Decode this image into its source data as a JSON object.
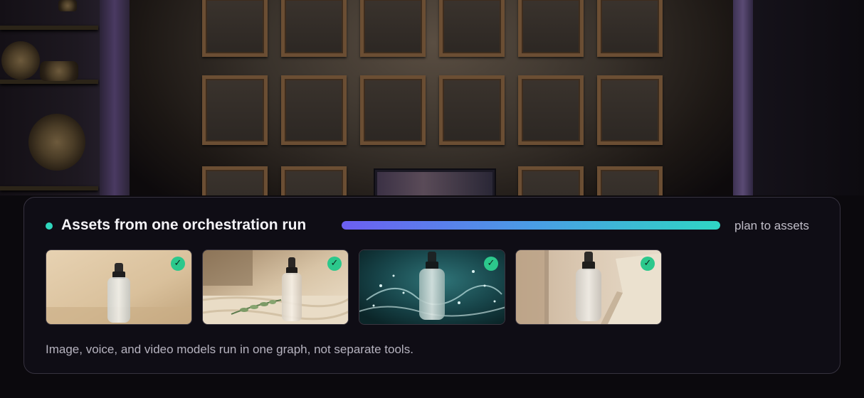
{
  "card": {
    "title": "Assets from one orchestration run",
    "progress": {
      "label": "plan to assets",
      "value_percent": 100,
      "gradient_colors": [
        "#6c5ff2",
        "#4a9ce6",
        "#2fd6c4"
      ]
    },
    "status_color": "#2fd6bd",
    "assets": [
      {
        "scene": "dropper-bottle-beige-backdrop",
        "status": "complete",
        "check_glyph": "✓"
      },
      {
        "scene": "dropper-bottle-linen-eucalyptus",
        "status": "complete",
        "check_glyph": "✓"
      },
      {
        "scene": "dropper-bottle-water-splash",
        "status": "complete",
        "check_glyph": "✓"
      },
      {
        "scene": "dropper-bottle-stone-slabs",
        "status": "complete",
        "check_glyph": "✓"
      }
    ],
    "caption": "Image, voice, and video models run in one graph, not separate tools."
  },
  "colors": {
    "check": "#2cc88c",
    "card_bg": "#100e16"
  }
}
